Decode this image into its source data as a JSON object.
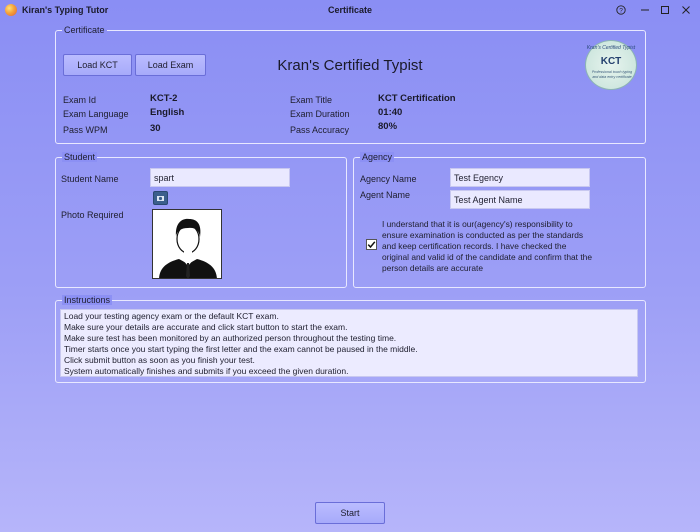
{
  "window": {
    "app_title": "Kiran's Typing Tutor",
    "title": "Certificate",
    "help_glyph": "?",
    "min_glyph": "—",
    "max_glyph": "☐",
    "close_glyph": "✕"
  },
  "certificate": {
    "group_label": "Certificate",
    "load_kct_label": "Load KCT",
    "load_exam_label": "Load Exam",
    "heading": "Kran's Certified Typist",
    "seal": {
      "top_text": "Kran's Certified Typist",
      "main_text": "KCT",
      "sub_text": "Professional touch typing and data entry certificate"
    },
    "exam_id_label": "Exam Id",
    "exam_id": "KCT-2",
    "exam_language_label": "Exam Language",
    "exam_language": "English",
    "pass_wpm_label": "Pass WPM",
    "pass_wpm": "30",
    "exam_title_label": "Exam Title",
    "exam_title": "KCT Certification",
    "exam_duration_label": "Exam Duration",
    "exam_duration": "01:40",
    "pass_accuracy_label": "Pass Accuracy",
    "pass_accuracy": "80%"
  },
  "student": {
    "group_label": "Student",
    "name_label": "Student Name",
    "name_value": "spart",
    "photo_label": "Photo Required"
  },
  "agency": {
    "group_label": "Agency",
    "agency_name_label": "Agency Name",
    "agency_name_value": "Test Egency",
    "agent_name_label": "Agent Name",
    "agent_name_value": "Test Agent Name",
    "agreement_checked": true,
    "agreement_text": "I understand that it is our(agency's) responsibility to ensure examination is conducted as per the standards and keep certification records. I have checked the original and valid id of the candidate and confirm that the person details are accurate"
  },
  "instructions": {
    "group_label": "Instructions",
    "lines": [
      "Load your testing agency exam or the default KCT exam.",
      "Make sure your details are accurate and click start button to start the exam.",
      "Make sure test has been monitored by an authorized person throughout the testing time.",
      "Timer starts once you start typing the first letter and the exam cannot be paused in the middle.",
      "Click submit button as soon as you finish your test.",
      "System automatically finishes and submits if you exceed the given duration."
    ]
  },
  "footer": {
    "start_label": "Start"
  },
  "colors": {
    "background_top": "#8a8ef4",
    "background_bottom": "#b6b5fa",
    "button": "#a9acfa",
    "input": "#eae9ff"
  }
}
